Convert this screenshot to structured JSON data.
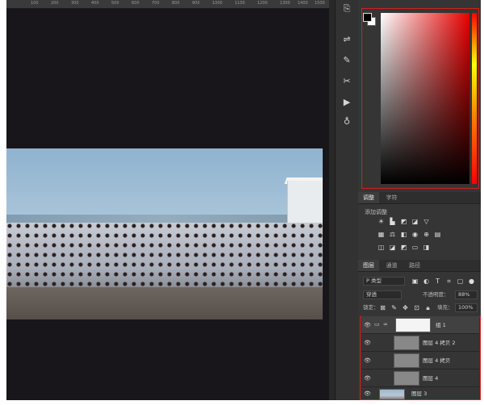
{
  "ruler": {
    "ticks": [
      "100",
      "200",
      "300",
      "400",
      "500",
      "600",
      "700",
      "800",
      "900",
      "1000",
      "1100",
      "1200",
      "1300",
      "1400",
      "1500"
    ]
  },
  "panels": {
    "adjust_tabs": [
      {
        "label": "调整"
      },
      {
        "label": "字符"
      }
    ],
    "adjust_title": "添加调整",
    "layers_tabs": [
      {
        "label": "图层"
      },
      {
        "label": "通道"
      },
      {
        "label": "路径"
      }
    ],
    "kind_filter": "P 类型",
    "blend_mode": "穿透",
    "opacity_label": "不透明度：",
    "opacity_value": "88%",
    "lock_label": "锁定：",
    "fill_label": "填充：",
    "fill_value": "100%"
  },
  "layers": [
    {
      "name": "组 1",
      "type": "group"
    },
    {
      "name": "图层 4 拷贝 2",
      "type": "layer"
    },
    {
      "name": "图层 4 拷贝",
      "type": "layer"
    },
    {
      "name": "图层 4",
      "type": "layer"
    },
    {
      "name": "图层 3",
      "type": "layer"
    }
  ],
  "colors": {
    "foreground": "#000000",
    "background": "#ffffff",
    "highlight": "#d32020"
  }
}
